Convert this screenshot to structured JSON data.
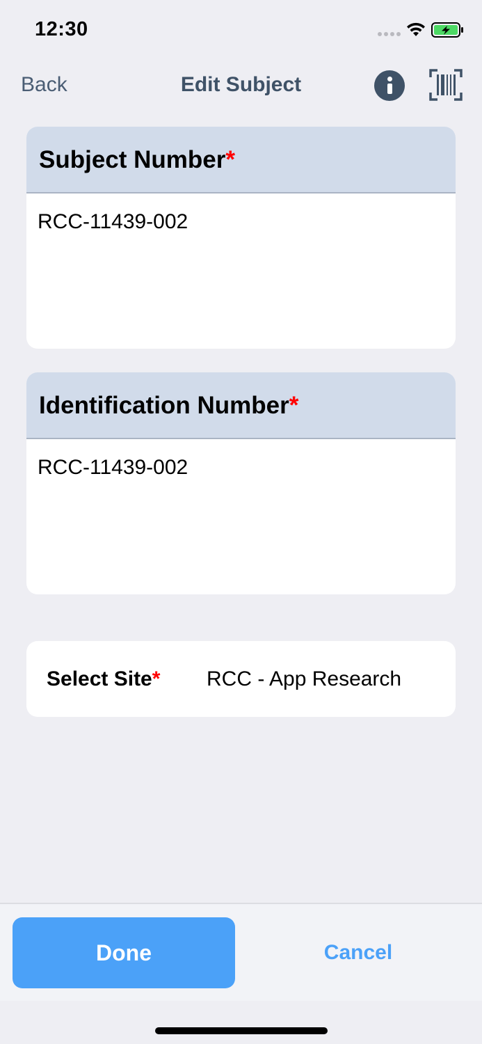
{
  "status_bar": {
    "time": "12:30"
  },
  "nav": {
    "back_label": "Back",
    "title": "Edit Subject"
  },
  "subject_number": {
    "label": "Subject Number",
    "required_mark": "*",
    "value": "RCC-11439-002"
  },
  "identification_number": {
    "label": "Identification Number",
    "required_mark": "*",
    "value": "RCC-11439-002"
  },
  "site": {
    "label": "Select Site",
    "required_mark": "*",
    "value": "RCC - App Research"
  },
  "actions": {
    "done_label": "Done",
    "cancel_label": "Cancel"
  },
  "colors": {
    "accent": "#4ba1f8",
    "header_fill": "#d1dbea",
    "nav_text": "#3f5267",
    "required": "#ff0000",
    "battery_fill": "#4cd964"
  },
  "icons": {
    "signal": "cellular-signal-icon",
    "wifi": "wifi-icon",
    "battery": "battery-charging-icon",
    "info": "info-icon",
    "barcode": "barcode-scan-icon"
  }
}
